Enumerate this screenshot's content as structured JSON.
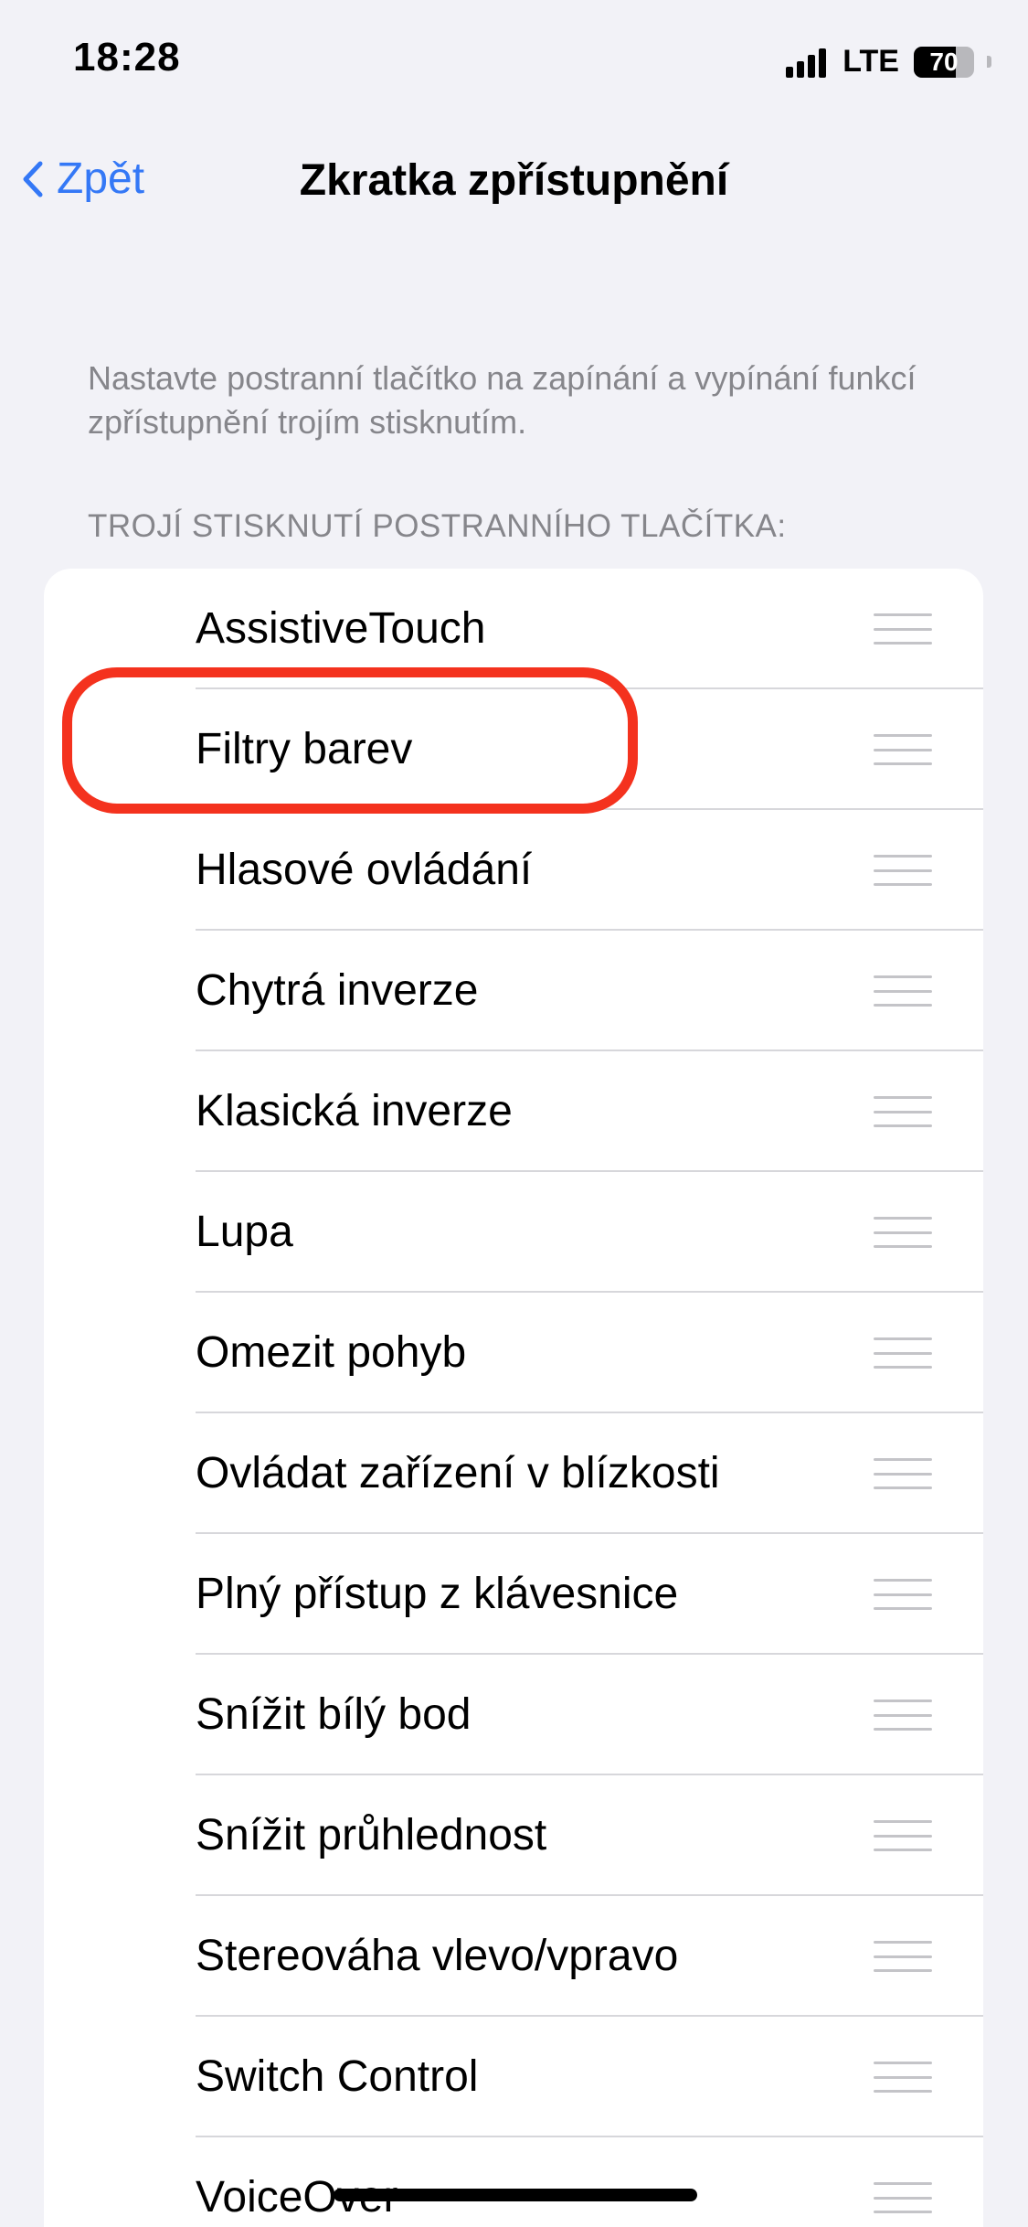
{
  "status_bar": {
    "time": "18:28",
    "network": "LTE",
    "battery_level": "70",
    "battery_fraction": 0.7
  },
  "nav": {
    "back_label": "Zpět",
    "title": "Zkratka zpřístupnění"
  },
  "description": "Nastavte postranní tlačítko na zapínání a vypínání funkcí zpřístupnění trojím stisknutím.",
  "section_header": "TROJÍ STISKNUTÍ POSTRANNÍHO TLAČÍTKA:",
  "items": [
    {
      "label": "AssistiveTouch"
    },
    {
      "label": "Filtry barev"
    },
    {
      "label": "Hlasové ovládání"
    },
    {
      "label": "Chytrá inverze"
    },
    {
      "label": "Klasická inverze"
    },
    {
      "label": "Lupa"
    },
    {
      "label": "Omezit pohyb"
    },
    {
      "label": "Ovládat zařízení v blízkosti"
    },
    {
      "label": "Plný přístup z klávesnice"
    },
    {
      "label": "Snížit bílý bod"
    },
    {
      "label": "Snížit průhlednost"
    },
    {
      "label": "Stereováha vlevo/vpravo"
    },
    {
      "label": "Switch Control"
    },
    {
      "label": "VoiceOver"
    }
  ],
  "colors": {
    "accent": "#3478F6",
    "highlight": "#F4321E",
    "background": "#F2F2F7"
  },
  "icons": {
    "back": "chevron-left-icon",
    "reorder": "reorder-handle-icon"
  }
}
